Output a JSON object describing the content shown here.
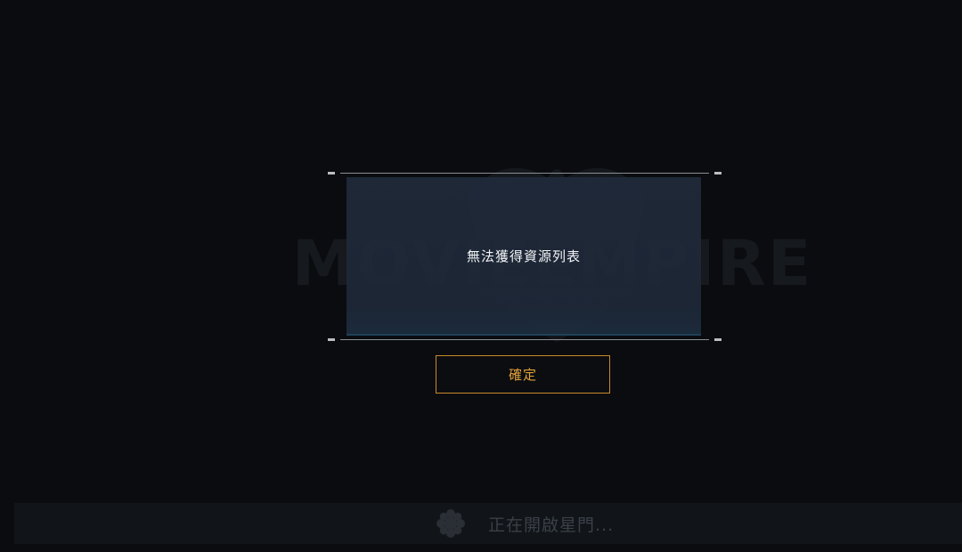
{
  "background": {
    "logo_text": "MOVIEEMPIRE"
  },
  "dialog": {
    "message": "無法獲得資源列表"
  },
  "confirm_button": {
    "label": "確定"
  },
  "loading": {
    "status_text": "正在開啟星門..."
  },
  "colors": {
    "background": "#0a0c0f",
    "dialog_body": "#1f2a3a",
    "accent": "#c98a2a",
    "frame": "#8a8f94"
  }
}
